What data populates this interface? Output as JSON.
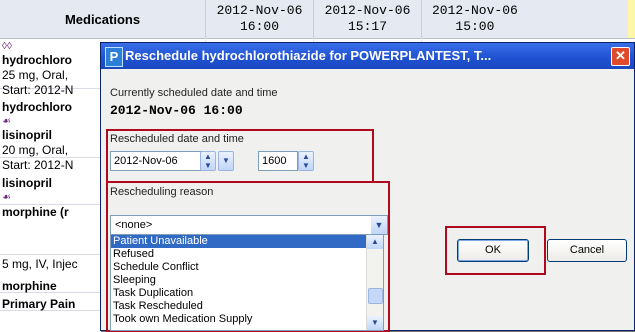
{
  "grid": {
    "header_title": "Medications",
    "columns": [
      {
        "date": "2012-Nov-06",
        "time": "16:00"
      },
      {
        "date": "2012-Nov-06",
        "time": "15:17"
      },
      {
        "date": "2012-Nov-06",
        "time": "15:00"
      }
    ],
    "rows": [
      {
        "text": "hydrochloro",
        "bold": true
      },
      {
        "text": "25 mg, Oral,",
        "bold": false
      },
      {
        "text": "Start: 2012-N",
        "bold": false
      },
      {
        "text": "hydrochloro",
        "bold": true
      },
      {
        "text": "lisinopril",
        "bold": true
      },
      {
        "text": "20 mg, Oral,",
        "bold": false
      },
      {
        "text": "Start: 2012-N",
        "bold": false
      },
      {
        "text": "lisinopril",
        "bold": true
      },
      {
        "text": "morphine (r",
        "bold": true
      },
      {
        "text": "5 mg, IV, Injec",
        "bold": false
      },
      {
        "text": "morphine",
        "bold": true
      },
      {
        "text": "Primary Pain",
        "bold": true
      }
    ]
  },
  "dialog": {
    "title": "Reschedule hydrochlorothiazide for POWERPLANTEST, T...",
    "logo": "P",
    "close_label": "✕",
    "current_label": "Currently scheduled date and time",
    "current_value": "2012-Nov-06  16:00",
    "rescheduled_label": "Rescheduled date and time",
    "rescheduled_date": "2012-Nov-06",
    "rescheduled_time": "1600",
    "reason_label": "Rescheduling reason",
    "reason_selected": "<none>",
    "reason_options": [
      "Patient Unavailable",
      "Refused",
      "Schedule Conflict",
      "Sleeping",
      "Task Duplication",
      "Task Rescheduled",
      "Took own Medication Supply"
    ],
    "highlighted_option": "Patient Unavailable",
    "ok_label": "OK",
    "cancel_label": "Cancel"
  },
  "colors": {
    "title_bar": "#1e50d0",
    "selection": "#316ac5",
    "annotation_red": "#b00a1c"
  }
}
